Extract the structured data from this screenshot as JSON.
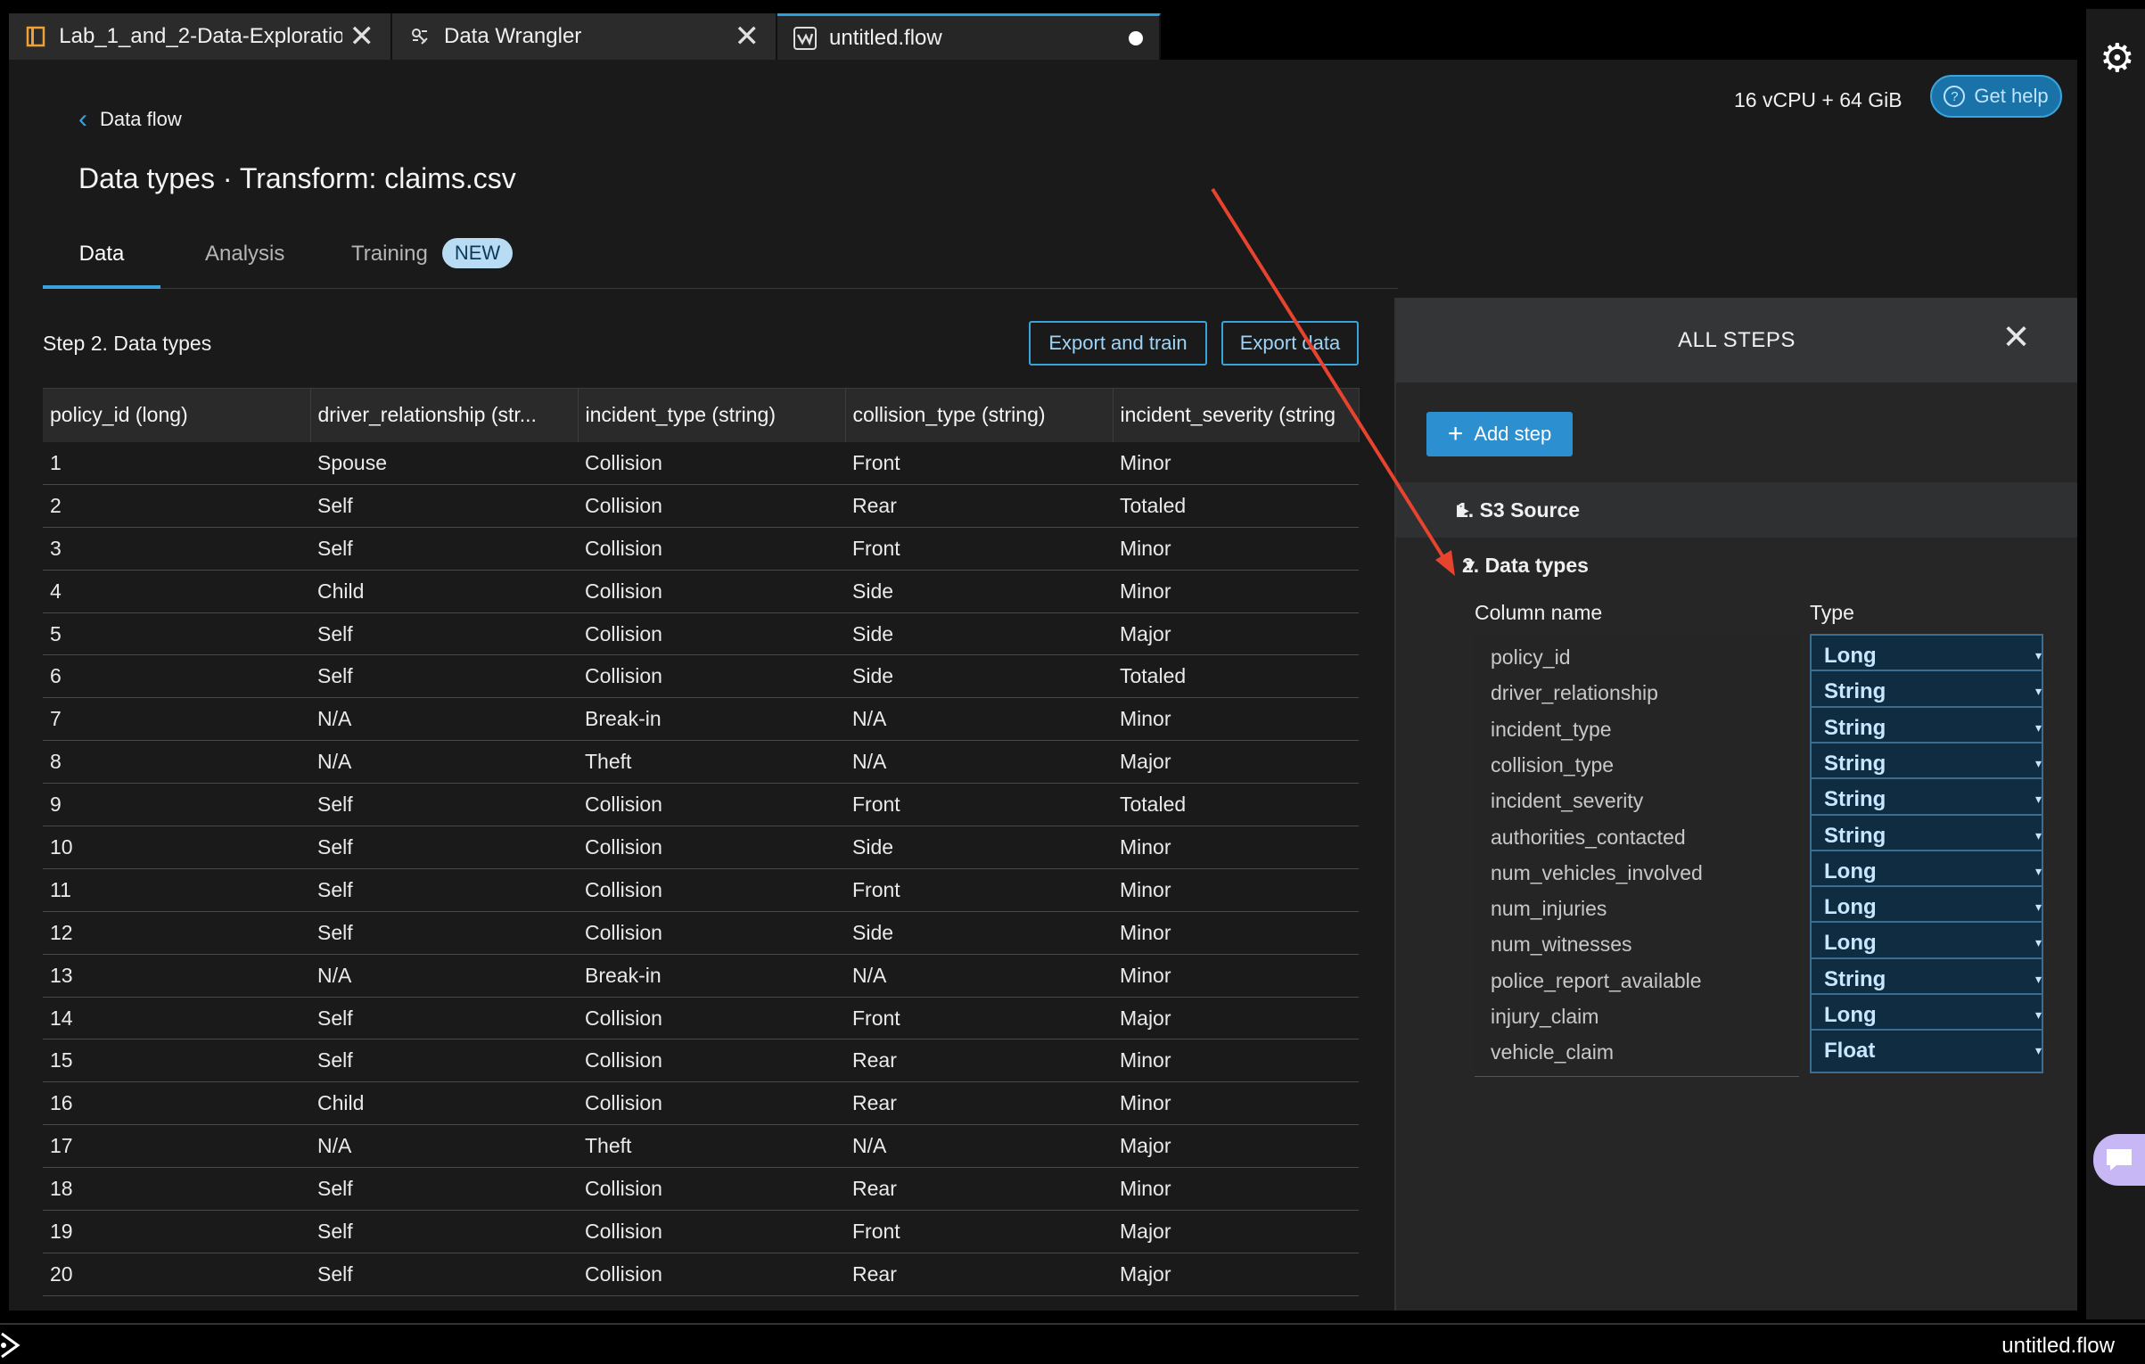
{
  "tabs": [
    {
      "label": "Lab_1_and_2-Data-Exploratio",
      "icon": "notebook-icon",
      "close": "✕"
    },
    {
      "label": "Data Wrangler",
      "icon": "data-wrangler-icon",
      "close": "✕"
    },
    {
      "label": "untitled.flow",
      "icon": "flow-icon",
      "active": true
    }
  ],
  "header": {
    "back_label": "Data flow",
    "title": "Data types · Transform: claims.csv",
    "resources": "16 vCPU + 64 GiB",
    "help_label": "Get help"
  },
  "subtabs": {
    "data": "Data",
    "analysis": "Analysis",
    "training": "Training",
    "new_badge": "NEW"
  },
  "step": {
    "title": "Step 2. Data types",
    "export_train": "Export and train",
    "export_data": "Export data"
  },
  "table": {
    "columns": [
      "policy_id (long)",
      "driver_relationship (str...",
      "incident_type (string)",
      "collision_type (string)",
      "incident_severity (string"
    ],
    "rows": [
      [
        "1",
        "Spouse",
        "Collision",
        "Front",
        "Minor"
      ],
      [
        "2",
        "Self",
        "Collision",
        "Rear",
        "Totaled"
      ],
      [
        "3",
        "Self",
        "Collision",
        "Front",
        "Minor"
      ],
      [
        "4",
        "Child",
        "Collision",
        "Side",
        "Minor"
      ],
      [
        "5",
        "Self",
        "Collision",
        "Side",
        "Major"
      ],
      [
        "6",
        "Self",
        "Collision",
        "Side",
        "Totaled"
      ],
      [
        "7",
        "N/A",
        "Break-in",
        "N/A",
        "Minor"
      ],
      [
        "8",
        "N/A",
        "Theft",
        "N/A",
        "Major"
      ],
      [
        "9",
        "Self",
        "Collision",
        "Front",
        "Totaled"
      ],
      [
        "10",
        "Self",
        "Collision",
        "Side",
        "Minor"
      ],
      [
        "11",
        "Self",
        "Collision",
        "Front",
        "Minor"
      ],
      [
        "12",
        "Self",
        "Collision",
        "Side",
        "Minor"
      ],
      [
        "13",
        "N/A",
        "Break-in",
        "N/A",
        "Minor"
      ],
      [
        "14",
        "Self",
        "Collision",
        "Front",
        "Major"
      ],
      [
        "15",
        "Self",
        "Collision",
        "Rear",
        "Minor"
      ],
      [
        "16",
        "Child",
        "Collision",
        "Rear",
        "Minor"
      ],
      [
        "17",
        "N/A",
        "Theft",
        "N/A",
        "Major"
      ],
      [
        "18",
        "Self",
        "Collision",
        "Rear",
        "Minor"
      ],
      [
        "19",
        "Self",
        "Collision",
        "Front",
        "Major"
      ],
      [
        "20",
        "Self",
        "Collision",
        "Rear",
        "Major"
      ]
    ]
  },
  "panel": {
    "title": "ALL STEPS",
    "add_step": "Add step",
    "step1": "1. S3 Source",
    "step2": "2. Data types",
    "col_name_header": "Column name",
    "type_header": "Type",
    "types": [
      {
        "name": "policy_id",
        "type": "Long"
      },
      {
        "name": "driver_relationship",
        "type": "String"
      },
      {
        "name": "incident_type",
        "type": "String"
      },
      {
        "name": "collision_type",
        "type": "String"
      },
      {
        "name": "incident_severity",
        "type": "String"
      },
      {
        "name": "authorities_contacted",
        "type": "String"
      },
      {
        "name": "num_vehicles_involved",
        "type": "Long"
      },
      {
        "name": "num_injuries",
        "type": "Long"
      },
      {
        "name": "num_witnesses",
        "type": "Long"
      },
      {
        "name": "police_report_available",
        "type": "String"
      },
      {
        "name": "injury_claim",
        "type": "Long"
      },
      {
        "name": "vehicle_claim",
        "type": "Float"
      }
    ]
  },
  "statusbar": {
    "filename": "untitled.flow"
  },
  "colors": {
    "accent": "#3aa3dc",
    "annotation_arrow": "#e8432e",
    "background": "#1a1a1a"
  }
}
